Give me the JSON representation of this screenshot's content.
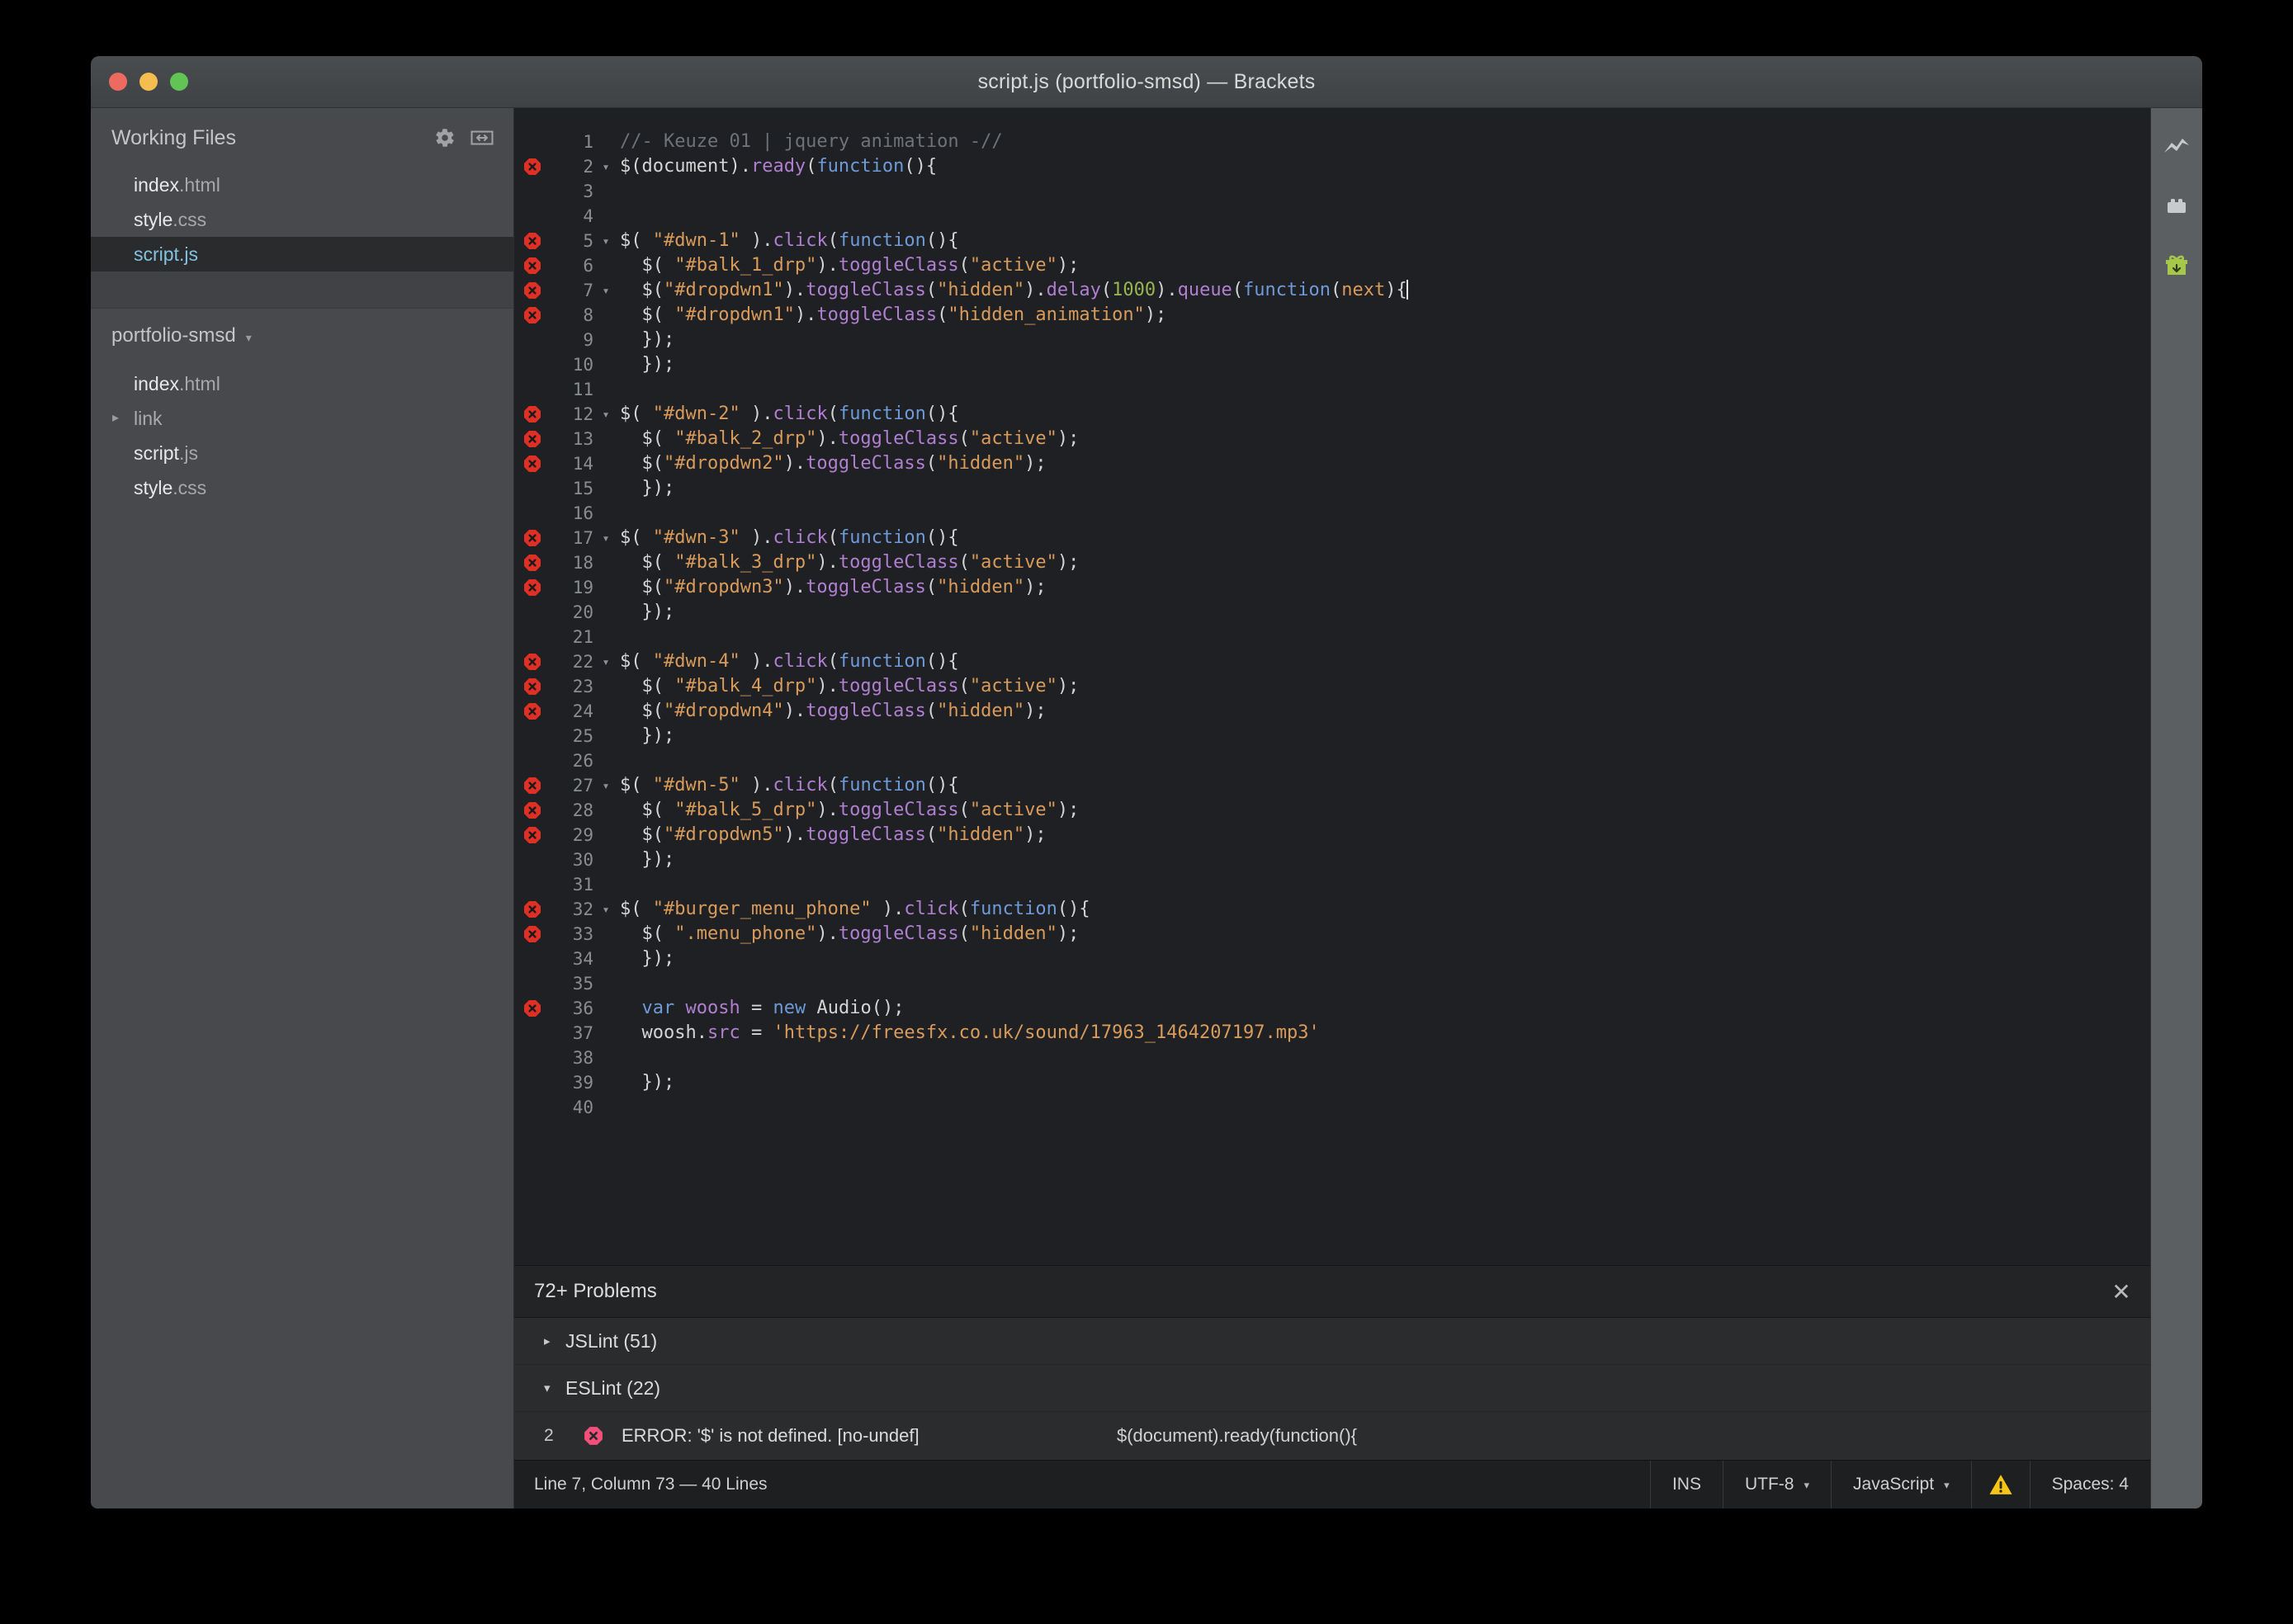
{
  "window": {
    "title": "script.js (portfolio-smsd) — Brackets",
    "traffic_lights": [
      "close",
      "minimize",
      "zoom"
    ]
  },
  "sidebar": {
    "working_files_title": "Working Files",
    "header_icons": [
      "gear-icon",
      "split-view-icon"
    ],
    "working_files": [
      {
        "base": "index",
        "ext": ".html",
        "selected": false
      },
      {
        "base": "style",
        "ext": ".css",
        "selected": false
      },
      {
        "base": "script",
        "ext": ".js",
        "selected": true
      }
    ],
    "project_name": "portfolio-smsd",
    "project_caret": "▾",
    "project_tree": [
      {
        "base": "index",
        "ext": ".html",
        "folder": false,
        "arrow": ""
      },
      {
        "base": "link",
        "ext": "",
        "folder": true,
        "arrow": "▸"
      },
      {
        "base": "script",
        "ext": ".js",
        "folder": false,
        "arrow": ""
      },
      {
        "base": "style",
        "ext": ".css",
        "folder": false,
        "arrow": ""
      }
    ]
  },
  "right_toolbar": {
    "icons": [
      {
        "name": "live-preview-icon",
        "color": "#c8cacb"
      },
      {
        "name": "extension-manager-icon",
        "color": "#c8cacb"
      },
      {
        "name": "gift-icon",
        "color": "#a6c84a"
      }
    ]
  },
  "editor": {
    "language": "JavaScript",
    "cursor_line": 7,
    "lines": [
      {
        "n": 1,
        "error": false,
        "fold": "",
        "tokens": [
          {
            "t": "//- Keuze 01 | jquery animation -//",
            "c": "c-com"
          }
        ]
      },
      {
        "n": 2,
        "error": true,
        "fold": "▾",
        "tokens": [
          {
            "t": "$(document).",
            "c": "c-plain"
          },
          {
            "t": "ready",
            "c": "c-fn"
          },
          {
            "t": "(",
            "c": "c-plain"
          },
          {
            "t": "function",
            "c": "c-kw"
          },
          {
            "t": "(){",
            "c": "c-plain"
          }
        ]
      },
      {
        "n": 3,
        "error": false,
        "fold": "",
        "tokens": []
      },
      {
        "n": 4,
        "error": false,
        "fold": "",
        "tokens": []
      },
      {
        "n": 5,
        "error": true,
        "fold": "▾",
        "tokens": [
          {
            "t": "$( ",
            "c": "c-plain"
          },
          {
            "t": "\"#dwn-1\"",
            "c": "c-str"
          },
          {
            "t": " ).",
            "c": "c-plain"
          },
          {
            "t": "click",
            "c": "c-fn"
          },
          {
            "t": "(",
            "c": "c-plain"
          },
          {
            "t": "function",
            "c": "c-kw"
          },
          {
            "t": "(){",
            "c": "c-plain"
          }
        ]
      },
      {
        "n": 6,
        "error": true,
        "fold": "",
        "tokens": [
          {
            "t": "  $( ",
            "c": "c-plain"
          },
          {
            "t": "\"#balk_1_drp\"",
            "c": "c-str"
          },
          {
            "t": ").",
            "c": "c-plain"
          },
          {
            "t": "toggleClass",
            "c": "c-fn"
          },
          {
            "t": "(",
            "c": "c-plain"
          },
          {
            "t": "\"active\"",
            "c": "c-str"
          },
          {
            "t": ");",
            "c": "c-plain"
          }
        ]
      },
      {
        "n": 7,
        "error": true,
        "fold": "▾",
        "tokens": [
          {
            "t": "  $(",
            "c": "c-plain"
          },
          {
            "t": "\"#dropdwn1\"",
            "c": "c-str"
          },
          {
            "t": ").",
            "c": "c-plain"
          },
          {
            "t": "toggleClass",
            "c": "c-fn"
          },
          {
            "t": "(",
            "c": "c-plain"
          },
          {
            "t": "\"hidden\"",
            "c": "c-str"
          },
          {
            "t": ").",
            "c": "c-plain"
          },
          {
            "t": "delay",
            "c": "c-fn"
          },
          {
            "t": "(",
            "c": "c-plain"
          },
          {
            "t": "1000",
            "c": "c-num"
          },
          {
            "t": ").",
            "c": "c-plain"
          },
          {
            "t": "queue",
            "c": "c-fn"
          },
          {
            "t": "(",
            "c": "c-plain"
          },
          {
            "t": "function",
            "c": "c-kw"
          },
          {
            "t": "(",
            "c": "c-plain"
          },
          {
            "t": "next",
            "c": "c-str"
          },
          {
            "t": "){",
            "c": "c-plain"
          }
        ]
      },
      {
        "n": 8,
        "error": true,
        "fold": "",
        "tokens": [
          {
            "t": "  $( ",
            "c": "c-plain"
          },
          {
            "t": "\"#dropdwn1\"",
            "c": "c-str"
          },
          {
            "t": ").",
            "c": "c-plain"
          },
          {
            "t": "toggleClass",
            "c": "c-fn"
          },
          {
            "t": "(",
            "c": "c-plain"
          },
          {
            "t": "\"hidden_animation\"",
            "c": "c-str"
          },
          {
            "t": ");",
            "c": "c-plain"
          }
        ]
      },
      {
        "n": 9,
        "error": false,
        "fold": "",
        "tokens": [
          {
            "t": "  });",
            "c": "c-plain"
          }
        ]
      },
      {
        "n": 10,
        "error": false,
        "fold": "",
        "tokens": [
          {
            "t": "  });",
            "c": "c-plain"
          }
        ]
      },
      {
        "n": 11,
        "error": false,
        "fold": "",
        "tokens": []
      },
      {
        "n": 12,
        "error": true,
        "fold": "▾",
        "tokens": [
          {
            "t": "$( ",
            "c": "c-plain"
          },
          {
            "t": "\"#dwn-2\"",
            "c": "c-str"
          },
          {
            "t": " ).",
            "c": "c-plain"
          },
          {
            "t": "click",
            "c": "c-fn"
          },
          {
            "t": "(",
            "c": "c-plain"
          },
          {
            "t": "function",
            "c": "c-kw"
          },
          {
            "t": "(){",
            "c": "c-plain"
          }
        ]
      },
      {
        "n": 13,
        "error": true,
        "fold": "",
        "tokens": [
          {
            "t": "  $( ",
            "c": "c-plain"
          },
          {
            "t": "\"#balk_2_drp\"",
            "c": "c-str"
          },
          {
            "t": ").",
            "c": "c-plain"
          },
          {
            "t": "toggleClass",
            "c": "c-fn"
          },
          {
            "t": "(",
            "c": "c-plain"
          },
          {
            "t": "\"active\"",
            "c": "c-str"
          },
          {
            "t": ");",
            "c": "c-plain"
          }
        ]
      },
      {
        "n": 14,
        "error": true,
        "fold": "",
        "tokens": [
          {
            "t": "  $(",
            "c": "c-plain"
          },
          {
            "t": "\"#dropdwn2\"",
            "c": "c-str"
          },
          {
            "t": ").",
            "c": "c-plain"
          },
          {
            "t": "toggleClass",
            "c": "c-fn"
          },
          {
            "t": "(",
            "c": "c-plain"
          },
          {
            "t": "\"hidden\"",
            "c": "c-str"
          },
          {
            "t": ");",
            "c": "c-plain"
          }
        ]
      },
      {
        "n": 15,
        "error": false,
        "fold": "",
        "tokens": [
          {
            "t": "  });",
            "c": "c-plain"
          }
        ]
      },
      {
        "n": 16,
        "error": false,
        "fold": "",
        "tokens": []
      },
      {
        "n": 17,
        "error": true,
        "fold": "▾",
        "tokens": [
          {
            "t": "$( ",
            "c": "c-plain"
          },
          {
            "t": "\"#dwn-3\"",
            "c": "c-str"
          },
          {
            "t": " ).",
            "c": "c-plain"
          },
          {
            "t": "click",
            "c": "c-fn"
          },
          {
            "t": "(",
            "c": "c-plain"
          },
          {
            "t": "function",
            "c": "c-kw"
          },
          {
            "t": "(){",
            "c": "c-plain"
          }
        ]
      },
      {
        "n": 18,
        "error": true,
        "fold": "",
        "tokens": [
          {
            "t": "  $( ",
            "c": "c-plain"
          },
          {
            "t": "\"#balk_3_drp\"",
            "c": "c-str"
          },
          {
            "t": ").",
            "c": "c-plain"
          },
          {
            "t": "toggleClass",
            "c": "c-fn"
          },
          {
            "t": "(",
            "c": "c-plain"
          },
          {
            "t": "\"active\"",
            "c": "c-str"
          },
          {
            "t": ");",
            "c": "c-plain"
          }
        ]
      },
      {
        "n": 19,
        "error": true,
        "fold": "",
        "tokens": [
          {
            "t": "  $(",
            "c": "c-plain"
          },
          {
            "t": "\"#dropdwn3\"",
            "c": "c-str"
          },
          {
            "t": ").",
            "c": "c-plain"
          },
          {
            "t": "toggleClass",
            "c": "c-fn"
          },
          {
            "t": "(",
            "c": "c-plain"
          },
          {
            "t": "\"hidden\"",
            "c": "c-str"
          },
          {
            "t": ");",
            "c": "c-plain"
          }
        ]
      },
      {
        "n": 20,
        "error": false,
        "fold": "",
        "tokens": [
          {
            "t": "  });",
            "c": "c-plain"
          }
        ]
      },
      {
        "n": 21,
        "error": false,
        "fold": "",
        "tokens": []
      },
      {
        "n": 22,
        "error": true,
        "fold": "▾",
        "tokens": [
          {
            "t": "$( ",
            "c": "c-plain"
          },
          {
            "t": "\"#dwn-4\"",
            "c": "c-str"
          },
          {
            "t": " ).",
            "c": "c-plain"
          },
          {
            "t": "click",
            "c": "c-fn"
          },
          {
            "t": "(",
            "c": "c-plain"
          },
          {
            "t": "function",
            "c": "c-kw"
          },
          {
            "t": "(){",
            "c": "c-plain"
          }
        ]
      },
      {
        "n": 23,
        "error": true,
        "fold": "",
        "tokens": [
          {
            "t": "  $( ",
            "c": "c-plain"
          },
          {
            "t": "\"#balk_4_drp\"",
            "c": "c-str"
          },
          {
            "t": ").",
            "c": "c-plain"
          },
          {
            "t": "toggleClass",
            "c": "c-fn"
          },
          {
            "t": "(",
            "c": "c-plain"
          },
          {
            "t": "\"active\"",
            "c": "c-str"
          },
          {
            "t": ");",
            "c": "c-plain"
          }
        ]
      },
      {
        "n": 24,
        "error": true,
        "fold": "",
        "tokens": [
          {
            "t": "  $(",
            "c": "c-plain"
          },
          {
            "t": "\"#dropdwn4\"",
            "c": "c-str"
          },
          {
            "t": ").",
            "c": "c-plain"
          },
          {
            "t": "toggleClass",
            "c": "c-fn"
          },
          {
            "t": "(",
            "c": "c-plain"
          },
          {
            "t": "\"hidden\"",
            "c": "c-str"
          },
          {
            "t": ");",
            "c": "c-plain"
          }
        ]
      },
      {
        "n": 25,
        "error": false,
        "fold": "",
        "tokens": [
          {
            "t": "  });",
            "c": "c-plain"
          }
        ]
      },
      {
        "n": 26,
        "error": false,
        "fold": "",
        "tokens": []
      },
      {
        "n": 27,
        "error": true,
        "fold": "▾",
        "tokens": [
          {
            "t": "$( ",
            "c": "c-plain"
          },
          {
            "t": "\"#dwn-5\"",
            "c": "c-str"
          },
          {
            "t": " ).",
            "c": "c-plain"
          },
          {
            "t": "click",
            "c": "c-fn"
          },
          {
            "t": "(",
            "c": "c-plain"
          },
          {
            "t": "function",
            "c": "c-kw"
          },
          {
            "t": "(){",
            "c": "c-plain"
          }
        ]
      },
      {
        "n": 28,
        "error": true,
        "fold": "",
        "tokens": [
          {
            "t": "  $( ",
            "c": "c-plain"
          },
          {
            "t": "\"#balk_5_drp\"",
            "c": "c-str"
          },
          {
            "t": ").",
            "c": "c-plain"
          },
          {
            "t": "toggleClass",
            "c": "c-fn"
          },
          {
            "t": "(",
            "c": "c-plain"
          },
          {
            "t": "\"active\"",
            "c": "c-str"
          },
          {
            "t": ");",
            "c": "c-plain"
          }
        ]
      },
      {
        "n": 29,
        "error": true,
        "fold": "",
        "tokens": [
          {
            "t": "  $(",
            "c": "c-plain"
          },
          {
            "t": "\"#dropdwn5\"",
            "c": "c-str"
          },
          {
            "t": ").",
            "c": "c-plain"
          },
          {
            "t": "toggleClass",
            "c": "c-fn"
          },
          {
            "t": "(",
            "c": "c-plain"
          },
          {
            "t": "\"hidden\"",
            "c": "c-str"
          },
          {
            "t": ");",
            "c": "c-plain"
          }
        ]
      },
      {
        "n": 30,
        "error": false,
        "fold": "",
        "tokens": [
          {
            "t": "  });",
            "c": "c-plain"
          }
        ]
      },
      {
        "n": 31,
        "error": false,
        "fold": "",
        "tokens": []
      },
      {
        "n": 32,
        "error": true,
        "fold": "▾",
        "tokens": [
          {
            "t": "$( ",
            "c": "c-plain"
          },
          {
            "t": "\"#burger_menu_phone\"",
            "c": "c-str"
          },
          {
            "t": " ).",
            "c": "c-plain"
          },
          {
            "t": "click",
            "c": "c-fn"
          },
          {
            "t": "(",
            "c": "c-plain"
          },
          {
            "t": "function",
            "c": "c-kw"
          },
          {
            "t": "(){",
            "c": "c-plain"
          }
        ]
      },
      {
        "n": 33,
        "error": true,
        "fold": "",
        "tokens": [
          {
            "t": "  $( ",
            "c": "c-plain"
          },
          {
            "t": "\".menu_phone\"",
            "c": "c-str"
          },
          {
            "t": ").",
            "c": "c-plain"
          },
          {
            "t": "toggleClass",
            "c": "c-fn"
          },
          {
            "t": "(",
            "c": "c-plain"
          },
          {
            "t": "\"hidden\"",
            "c": "c-str"
          },
          {
            "t": ");",
            "c": "c-plain"
          }
        ]
      },
      {
        "n": 34,
        "error": false,
        "fold": "",
        "tokens": [
          {
            "t": "  });",
            "c": "c-plain"
          }
        ]
      },
      {
        "n": 35,
        "error": false,
        "fold": "",
        "tokens": []
      },
      {
        "n": 36,
        "error": true,
        "fold": "",
        "tokens": [
          {
            "t": "  ",
            "c": "c-plain"
          },
          {
            "t": "var",
            "c": "c-kw"
          },
          {
            "t": " ",
            "c": "c-plain"
          },
          {
            "t": "woosh",
            "c": "c-var"
          },
          {
            "t": " = ",
            "c": "c-plain"
          },
          {
            "t": "new",
            "c": "c-kw"
          },
          {
            "t": " Audio();",
            "c": "c-plain"
          }
        ]
      },
      {
        "n": 37,
        "error": false,
        "fold": "",
        "tokens": [
          {
            "t": "  woosh.",
            "c": "c-plain"
          },
          {
            "t": "src",
            "c": "c-var"
          },
          {
            "t": " = ",
            "c": "c-plain"
          },
          {
            "t": "'https://freesfx.co.uk/sound/17963_1464207197.mp3'",
            "c": "c-str"
          }
        ]
      },
      {
        "n": 38,
        "error": false,
        "fold": "",
        "tokens": []
      },
      {
        "n": 39,
        "error": false,
        "fold": "",
        "tokens": [
          {
            "t": "  });",
            "c": "c-plain"
          }
        ]
      },
      {
        "n": 40,
        "error": false,
        "fold": "",
        "tokens": []
      }
    ]
  },
  "problems": {
    "title": "72+ Problems",
    "close_label": "✕",
    "groups": [
      {
        "twisty": "▸",
        "label": "JSLint (51)",
        "expanded": false,
        "rows": []
      },
      {
        "twisty": "▾",
        "label": "ESLint (22)",
        "expanded": true,
        "rows": [
          {
            "line": "2",
            "message": "ERROR: '$' is not defined. [no-undef]",
            "code": "$(document).ready(function(){"
          }
        ]
      }
    ]
  },
  "statusbar": {
    "cursor_info": "Line 7, Column 73 — 40 Lines",
    "insert_mode": "INS",
    "encoding": "UTF-8",
    "encoding_caret": "▾",
    "language": "JavaScript",
    "language_caret": "▾",
    "warning_icon": "warning-triangle-icon",
    "indent": "Spaces:  4"
  },
  "colors": {
    "accent_selected_file": "#82c2e0",
    "error_red": "#e02f25",
    "warning_yellow": "#f5c518",
    "gift_green": "#a6c84a",
    "editor_bg": "#1f2023",
    "sidebar_bg": "#47494d"
  }
}
